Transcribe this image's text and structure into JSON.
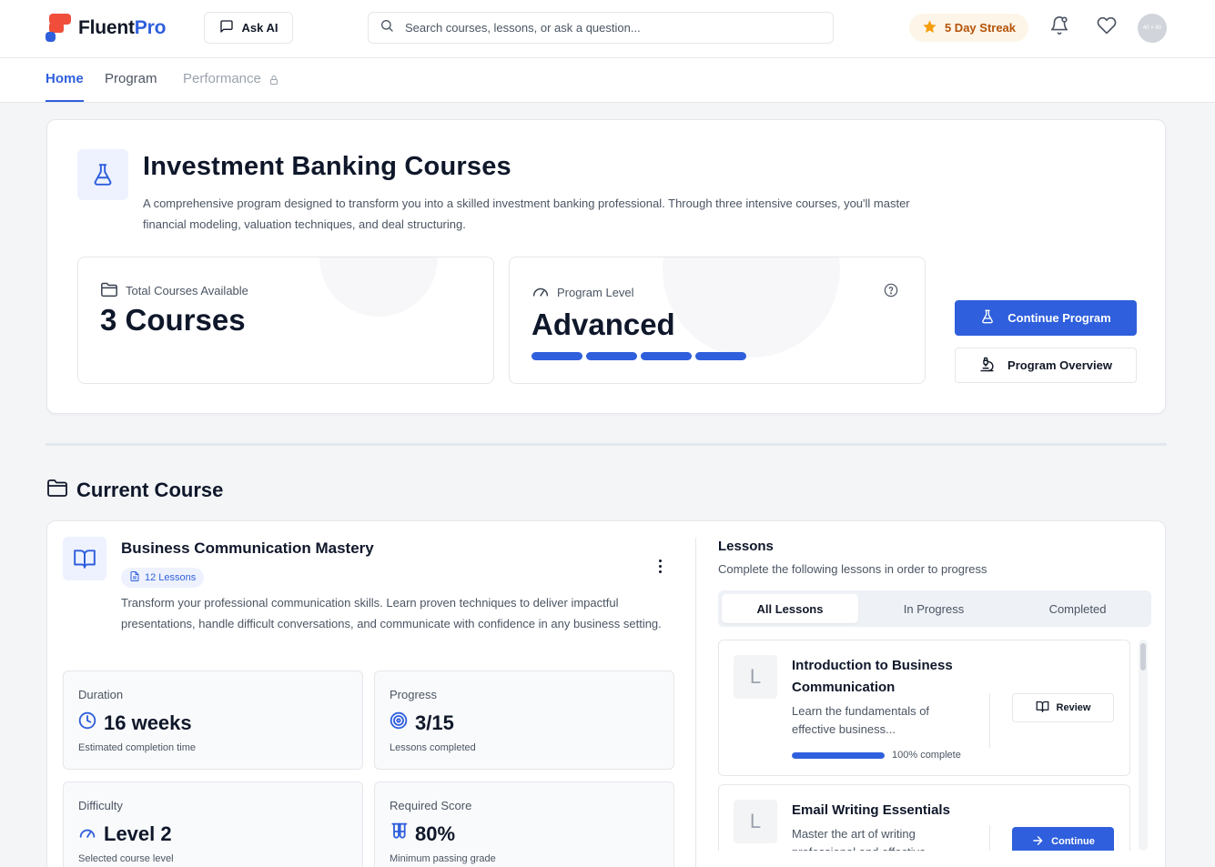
{
  "brand": {
    "name_primary": "Fluent",
    "name_accent": "Pro",
    "accent_color": "#2f5fdc",
    "logo_color": "#f04e3a"
  },
  "header": {
    "ask_ai_label": "Ask AI",
    "search_placeholder": "Search courses, lessons, or ask a question...",
    "streak_label": "5 Day Streak",
    "avatar_text": "40 × 40",
    "icons": [
      "message-square-icon",
      "search-icon",
      "star-icon",
      "bell-icon",
      "heart-icon"
    ]
  },
  "nav": {
    "tabs": [
      {
        "label": "Home",
        "state": "active"
      },
      {
        "label": "Program",
        "state": "default"
      },
      {
        "label": "Performance",
        "state": "locked"
      }
    ]
  },
  "program": {
    "title": "Investment Banking Courses",
    "description": "A comprehensive program designed to transform you into a skilled investment banking professional. Through three intensive courses, you'll master financial modeling, valuation techniques, and deal structuring.",
    "total_courses_label": "Total Courses Available",
    "total_courses_value": "3 Courses",
    "level_label": "Program Level",
    "level_value": "Advanced",
    "level_bars_filled": 4,
    "continue_label": "Continue Program",
    "overview_label": "Program Overview"
  },
  "current_course": {
    "section_title": "Current Course",
    "title": "Business Communication Mastery",
    "lessons_badge": "12 Lessons",
    "description": "Transform your professional communication skills. Learn proven techniques to deliver impactful presentations, handle difficult conversations, and communicate with confidence in any business setting.",
    "stats": [
      {
        "label": "Duration",
        "value": "16 weeks",
        "sub": "Estimated completion time",
        "icon": "clock-icon"
      },
      {
        "label": "Progress",
        "value": "3/15",
        "sub": "Lessons completed",
        "icon": "target-icon"
      },
      {
        "label": "Difficulty",
        "value": "Level 2",
        "sub": "Selected course level",
        "icon": "gauge-icon"
      },
      {
        "label": "Required Score",
        "value": "80%",
        "sub": "Minimum passing grade",
        "icon": "test-tubes-icon"
      }
    ]
  },
  "lessons": {
    "heading": "Lessons",
    "subheading": "Complete the following lessons in order to progress",
    "tabs": [
      "All Lessons",
      "In Progress",
      "Completed"
    ],
    "active_tab": 0,
    "items": [
      {
        "avatar": "L",
        "title": "Introduction to Business Communication",
        "desc": "Learn the fundamentals of effective business...",
        "progress": 1.0,
        "progress_label": "100% complete",
        "action": "Review"
      },
      {
        "avatar": "L",
        "title": "Email Writing Essentials",
        "desc": "Master the art of writing professional and effective...",
        "action": "Continue"
      }
    ]
  }
}
